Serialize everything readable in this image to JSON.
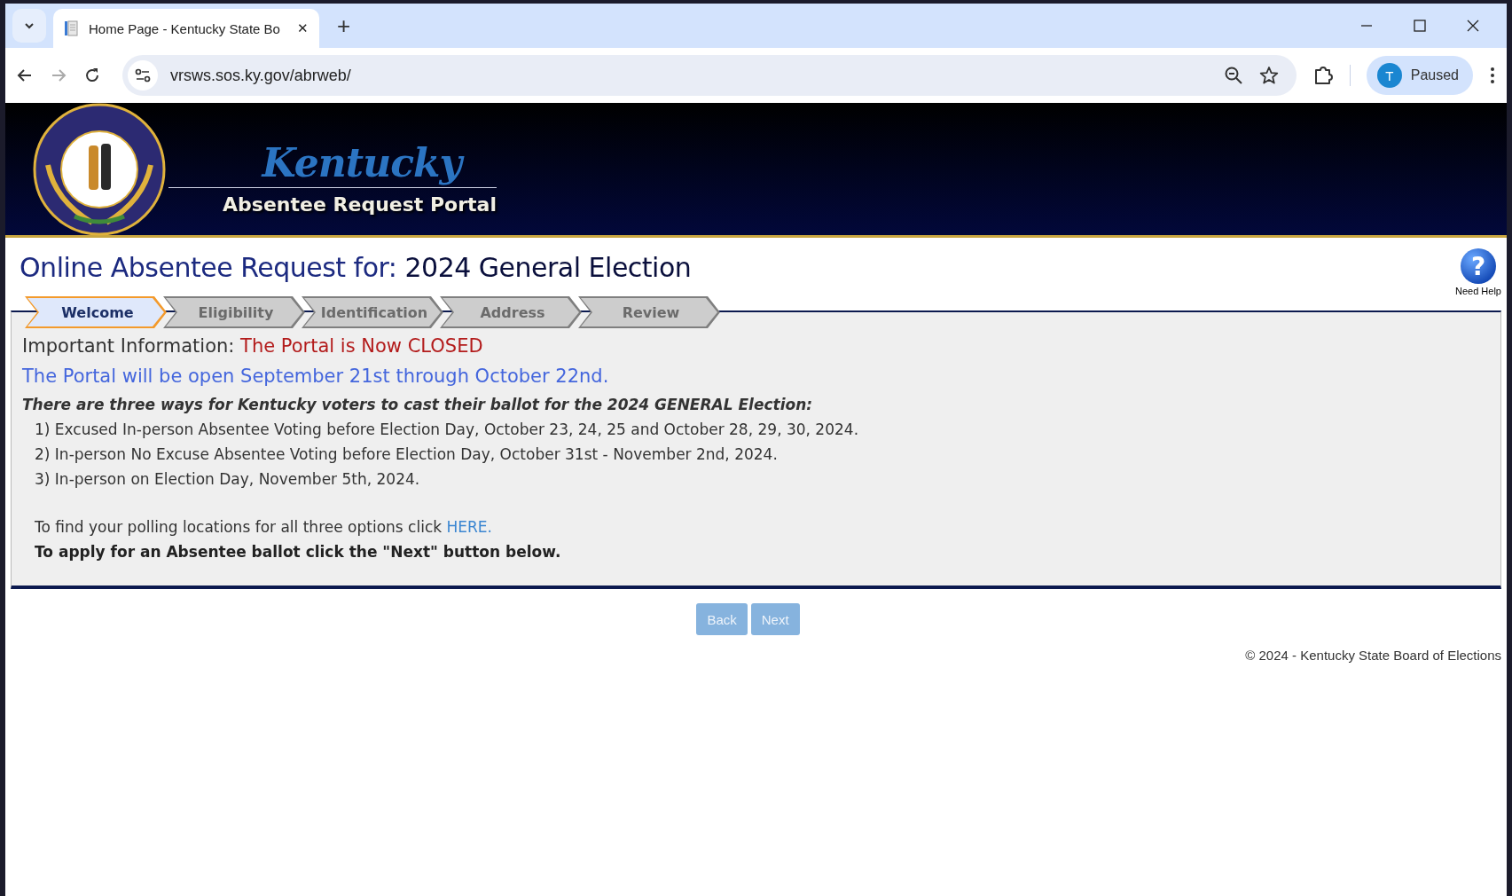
{
  "browser": {
    "tab": {
      "title": "Home Page - Kentucky State Bo",
      "close": "✕"
    },
    "new_tab": "+",
    "url": "vrsws.sos.ky.gov/abrweb/",
    "profile": {
      "initial": "T",
      "status": "Paused"
    }
  },
  "banner": {
    "logo": "Kentucky",
    "subtitle": "Absentee Request Portal"
  },
  "heading": {
    "lead": "Online Absentee Request for:",
    "election": "2024 General Election"
  },
  "help": {
    "glyph": "?",
    "label": "Need Help"
  },
  "steps": [
    {
      "label": "Welcome",
      "selected": true
    },
    {
      "label": "Eligibility",
      "selected": false
    },
    {
      "label": "Identification",
      "selected": false
    },
    {
      "label": "Address",
      "selected": false
    },
    {
      "label": "Review",
      "selected": false
    }
  ],
  "notice": {
    "label": "Important Information:",
    "status": "The Portal is Now CLOSED",
    "schedule": "The Portal will be open September 21st through October 22nd.",
    "intro": "There are three ways for Kentucky voters to cast their ballot for the 2024 GENERAL Election:",
    "options": [
      "1) Excused In-person Absentee Voting before Election Day, October 23, 24, 25 and October 28, 29, 30, 2024.",
      "2) In-person No Excuse Absentee Voting before Election Day, October 31st - November 2nd, 2024.",
      "3) In-person on Election Day, November 5th, 2024."
    ],
    "polling_text": "To find your polling locations for all three options click",
    "polling_link": "HERE.",
    "apply_text": "To apply for an Absentee ballot click the \"Next\" button below."
  },
  "buttons": [
    {
      "label": "Back",
      "disabled": true
    },
    {
      "label": "Next",
      "disabled": true
    }
  ],
  "footer": "© 2024 - Kentucky State Board of Elections"
}
